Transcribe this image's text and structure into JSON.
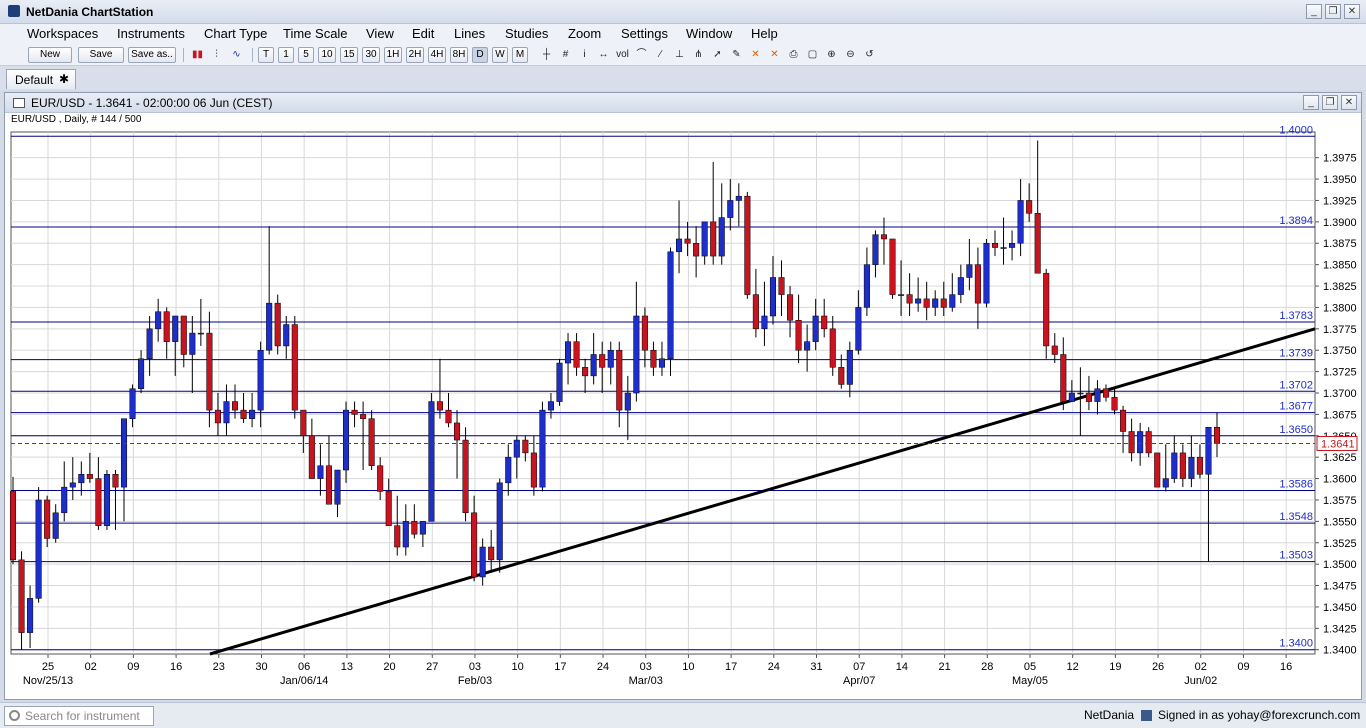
{
  "app": {
    "title": "NetDania ChartStation"
  },
  "menu": [
    "Workspaces",
    "Instruments",
    "Chart Type",
    "Time Scale",
    "View",
    "Edit",
    "Lines",
    "Studies",
    "Zoom",
    "Settings",
    "Window",
    "Help"
  ],
  "toolbar": {
    "new_label": "New",
    "save_label": "Save",
    "saveas_label": "Save as..",
    "timescales": [
      "T",
      "1",
      "5",
      "10",
      "15",
      "30",
      "1H",
      "2H",
      "4H",
      "8H",
      "D",
      "W",
      "M"
    ],
    "tools": [
      "crosshair-icon",
      "grid-icon",
      "info-icon",
      "scroll-icon",
      "volume-icon",
      "line-tool-icon",
      "fib-icon",
      "channel-icon",
      "pitchfork-icon",
      "cursor-icon",
      "pen-icon",
      "delete-lines-icon",
      "delete-studies-icon",
      "print-icon",
      "print-preview-icon",
      "zoom-in-icon",
      "zoom-out-icon",
      "zoom-reset-icon"
    ]
  },
  "tabs": [
    {
      "label": "Default",
      "close": "✱"
    }
  ],
  "chart_window": {
    "title": "EUR/USD - 1.3641 - 02:00:00  06 Jun (CEST)",
    "subtitle": "EUR/USD , Daily, # 144 / 500"
  },
  "chart_data": {
    "type": "candlestick",
    "instrument": "EUR/USD",
    "timeframe": "Daily",
    "ylim": [
      1.3395,
      1.4005
    ],
    "y_ticks": [
      "1.3400",
      "1.3425",
      "1.3450",
      "1.3475",
      "1.3500",
      "1.3525",
      "1.3550",
      "1.3575",
      "1.3600",
      "1.3625",
      "1.3650",
      "1.3675",
      "1.3700",
      "1.3725",
      "1.3750",
      "1.3775",
      "1.3800",
      "1.3825",
      "1.3850",
      "1.3875",
      "1.3900",
      "1.3925",
      "1.3950",
      "1.3975"
    ],
    "x_ticks": [
      "25",
      "02",
      "09",
      "16",
      "23",
      "30",
      "06",
      "13",
      "20",
      "27",
      "03",
      "10",
      "17",
      "24",
      "03",
      "10",
      "17",
      "24",
      "31",
      "07",
      "14",
      "21",
      "28",
      "05",
      "12",
      "19",
      "26",
      "02",
      "09",
      "16"
    ],
    "month_labels": [
      {
        "tick_index": 0,
        "label": "Nov/25/13"
      },
      {
        "tick_index": 6,
        "label": "Jan/06/14"
      },
      {
        "tick_index": 10,
        "label": "Feb/03"
      },
      {
        "tick_index": 14,
        "label": "Mar/03"
      },
      {
        "tick_index": 19,
        "label": "Apr/07"
      },
      {
        "tick_index": 23,
        "label": "May/05"
      },
      {
        "tick_index": 27,
        "label": "Jun/02"
      }
    ],
    "horizontal_levels": [
      "1.3400",
      "1.3503",
      "1.3548",
      "1.3586",
      "1.3650",
      "1.3677",
      "1.3702",
      "1.3739",
      "1.3783",
      "1.3894",
      "1.4000"
    ],
    "last_price": "1.3641",
    "trendline": {
      "from": [
        "2013-12-23",
        1.3395
      ],
      "to": [
        "2014-06-16",
        1.3775
      ]
    },
    "candles_ohlc": [
      [
        1.3585,
        1.3602,
        1.35,
        1.3505
      ],
      [
        1.3505,
        1.3515,
        1.34,
        1.342
      ],
      [
        1.342,
        1.3475,
        1.3402,
        1.346
      ],
      [
        1.346,
        1.359,
        1.3455,
        1.3575
      ],
      [
        1.3575,
        1.358,
        1.352,
        1.353
      ],
      [
        1.353,
        1.357,
        1.3525,
        1.356
      ],
      [
        1.356,
        1.362,
        1.355,
        1.359
      ],
      [
        1.359,
        1.3625,
        1.3575,
        1.3595
      ],
      [
        1.3595,
        1.362,
        1.358,
        1.3605
      ],
      [
        1.3605,
        1.363,
        1.3595,
        1.36
      ],
      [
        1.36,
        1.3625,
        1.354,
        1.3545
      ],
      [
        1.3545,
        1.361,
        1.354,
        1.3605
      ],
      [
        1.3605,
        1.361,
        1.354,
        1.359
      ],
      [
        1.359,
        1.367,
        1.355,
        1.367
      ],
      [
        1.367,
        1.371,
        1.366,
        1.3705
      ],
      [
        1.3705,
        1.375,
        1.37,
        1.374
      ],
      [
        1.374,
        1.379,
        1.372,
        1.3775
      ],
      [
        1.3775,
        1.381,
        1.376,
        1.3795
      ],
      [
        1.3795,
        1.38,
        1.374,
        1.376
      ],
      [
        1.376,
        1.379,
        1.372,
        1.379
      ],
      [
        1.379,
        1.379,
        1.373,
        1.3745
      ],
      [
        1.3745,
        1.379,
        1.37,
        1.377
      ],
      [
        1.377,
        1.381,
        1.3755,
        1.377
      ],
      [
        1.377,
        1.3795,
        1.366,
        1.368
      ],
      [
        1.368,
        1.37,
        1.365,
        1.3665
      ],
      [
        1.3665,
        1.371,
        1.365,
        1.369
      ],
      [
        1.369,
        1.371,
        1.367,
        1.368
      ],
      [
        1.368,
        1.37,
        1.3665,
        1.367
      ],
      [
        1.367,
        1.37,
        1.366,
        1.368
      ],
      [
        1.368,
        1.376,
        1.366,
        1.375
      ],
      [
        1.375,
        1.3895,
        1.3745,
        1.3805
      ],
      [
        1.3805,
        1.3815,
        1.3745,
        1.3755
      ],
      [
        1.3755,
        1.379,
        1.374,
        1.378
      ],
      [
        1.378,
        1.379,
        1.367,
        1.368
      ],
      [
        1.368,
        1.367,
        1.363,
        1.365
      ],
      [
        1.365,
        1.367,
        1.36,
        1.36
      ],
      [
        1.36,
        1.364,
        1.358,
        1.3615
      ],
      [
        1.3615,
        1.365,
        1.357,
        1.357
      ],
      [
        1.357,
        1.361,
        1.3555,
        1.361
      ],
      [
        1.361,
        1.369,
        1.3595,
        1.368
      ],
      [
        1.368,
        1.369,
        1.366,
        1.3675
      ],
      [
        1.3675,
        1.369,
        1.361,
        1.367
      ],
      [
        1.367,
        1.368,
        1.361,
        1.3615
      ],
      [
        1.3615,
        1.3625,
        1.3575,
        1.3585
      ],
      [
        1.3585,
        1.36,
        1.3545,
        1.3545
      ],
      [
        1.3545,
        1.358,
        1.351,
        1.352
      ],
      [
        1.352,
        1.357,
        1.351,
        1.355
      ],
      [
        1.355,
        1.357,
        1.353,
        1.3535
      ],
      [
        1.3535,
        1.355,
        1.352,
        1.355
      ],
      [
        1.355,
        1.37,
        1.355,
        1.369
      ],
      [
        1.369,
        1.374,
        1.367,
        1.368
      ],
      [
        1.368,
        1.37,
        1.366,
        1.3665
      ],
      [
        1.3665,
        1.368,
        1.36,
        1.3645
      ],
      [
        1.3645,
        1.366,
        1.355,
        1.356
      ],
      [
        1.356,
        1.358,
        1.348,
        1.3485
      ],
      [
        1.3485,
        1.353,
        1.3475,
        1.352
      ],
      [
        1.352,
        1.354,
        1.349,
        1.3505
      ],
      [
        1.3505,
        1.36,
        1.349,
        1.3595
      ],
      [
        1.3595,
        1.364,
        1.358,
        1.3625
      ],
      [
        1.3625,
        1.365,
        1.36,
        1.3645
      ],
      [
        1.3645,
        1.365,
        1.362,
        1.363
      ],
      [
        1.363,
        1.365,
        1.358,
        1.359
      ],
      [
        1.359,
        1.369,
        1.3585,
        1.368
      ],
      [
        1.368,
        1.37,
        1.367,
        1.369
      ],
      [
        1.369,
        1.374,
        1.3685,
        1.3735
      ],
      [
        1.3735,
        1.377,
        1.371,
        1.376
      ],
      [
        1.376,
        1.377,
        1.372,
        1.373
      ],
      [
        1.373,
        1.374,
        1.37,
        1.372
      ],
      [
        1.372,
        1.377,
        1.371,
        1.3745
      ],
      [
        1.3745,
        1.376,
        1.37,
        1.373
      ],
      [
        1.373,
        1.376,
        1.371,
        1.375
      ],
      [
        1.375,
        1.376,
        1.366,
        1.368
      ],
      [
        1.368,
        1.372,
        1.3645,
        1.37
      ],
      [
        1.37,
        1.383,
        1.369,
        1.379
      ],
      [
        1.379,
        1.38,
        1.373,
        1.375
      ],
      [
        1.375,
        1.376,
        1.372,
        1.373
      ],
      [
        1.373,
        1.376,
        1.372,
        1.374
      ],
      [
        1.374,
        1.387,
        1.372,
        1.3865
      ],
      [
        1.3865,
        1.3925,
        1.384,
        1.388
      ],
      [
        1.388,
        1.39,
        1.386,
        1.3875
      ],
      [
        1.3875,
        1.3895,
        1.3835,
        1.386
      ],
      [
        1.386,
        1.39,
        1.385,
        1.39
      ],
      [
        1.39,
        1.397,
        1.385,
        1.386
      ],
      [
        1.386,
        1.3945,
        1.385,
        1.3905
      ],
      [
        1.3905,
        1.395,
        1.389,
        1.3925
      ],
      [
        1.3925,
        1.3945,
        1.3895,
        1.393
      ],
      [
        1.393,
        1.3935,
        1.381,
        1.3815
      ],
      [
        1.3815,
        1.3845,
        1.3765,
        1.3775
      ],
      [
        1.3775,
        1.383,
        1.3755,
        1.379
      ],
      [
        1.379,
        1.386,
        1.378,
        1.3835
      ],
      [
        1.3835,
        1.3855,
        1.379,
        1.3815
      ],
      [
        1.3815,
        1.3825,
        1.3765,
        1.3785
      ],
      [
        1.3785,
        1.3815,
        1.3735,
        1.375
      ],
      [
        1.375,
        1.378,
        1.3725,
        1.376
      ],
      [
        1.376,
        1.381,
        1.375,
        1.379
      ],
      [
        1.379,
        1.381,
        1.3765,
        1.3775
      ],
      [
        1.3775,
        1.379,
        1.372,
        1.373
      ],
      [
        1.373,
        1.3745,
        1.3705,
        1.371
      ],
      [
        1.371,
        1.376,
        1.3695,
        1.375
      ],
      [
        1.375,
        1.382,
        1.3745,
        1.38
      ],
      [
        1.38,
        1.387,
        1.379,
        1.385
      ],
      [
        1.385,
        1.389,
        1.3835,
        1.3885
      ],
      [
        1.3885,
        1.3905,
        1.385,
        1.388
      ],
      [
        1.388,
        1.386,
        1.381,
        1.3815
      ],
      [
        1.3815,
        1.3855,
        1.379,
        1.3815
      ],
      [
        1.3815,
        1.384,
        1.379,
        1.3805
      ],
      [
        1.3805,
        1.3835,
        1.3795,
        1.381
      ],
      [
        1.381,
        1.383,
        1.3785,
        1.38
      ],
      [
        1.38,
        1.382,
        1.379,
        1.381
      ],
      [
        1.381,
        1.383,
        1.379,
        1.38
      ],
      [
        1.38,
        1.384,
        1.3795,
        1.3815
      ],
      [
        1.3815,
        1.385,
        1.3805,
        1.3835
      ],
      [
        1.3835,
        1.388,
        1.382,
        1.385
      ],
      [
        1.385,
        1.387,
        1.3775,
        1.3805
      ],
      [
        1.3805,
        1.388,
        1.38,
        1.3875
      ],
      [
        1.3875,
        1.389,
        1.386,
        1.387
      ],
      [
        1.387,
        1.3905,
        1.385,
        1.387
      ],
      [
        1.387,
        1.389,
        1.3855,
        1.3875
      ],
      [
        1.3875,
        1.395,
        1.386,
        1.3925
      ],
      [
        1.3925,
        1.3945,
        1.39,
        1.391
      ],
      [
        1.391,
        1.3995,
        1.384,
        1.384
      ],
      [
        1.384,
        1.3845,
        1.374,
        1.3755
      ],
      [
        1.3755,
        1.377,
        1.3735,
        1.3745
      ],
      [
        1.3745,
        1.3765,
        1.368,
        1.369
      ],
      [
        1.369,
        1.3715,
        1.369,
        1.37
      ],
      [
        1.37,
        1.373,
        1.365,
        1.37
      ],
      [
        1.37,
        1.372,
        1.368,
        1.369
      ],
      [
        1.369,
        1.3715,
        1.3675,
        1.3705
      ],
      [
        1.3705,
        1.371,
        1.369,
        1.3695
      ],
      [
        1.3695,
        1.3705,
        1.3675,
        1.368
      ],
      [
        1.368,
        1.3685,
        1.363,
        1.3655
      ],
      [
        1.3655,
        1.367,
        1.362,
        1.363
      ],
      [
        1.363,
        1.3665,
        1.3615,
        1.3655
      ],
      [
        1.3655,
        1.366,
        1.3625,
        1.363
      ],
      [
        1.363,
        1.363,
        1.359,
        1.359
      ],
      [
        1.359,
        1.364,
        1.3585,
        1.36
      ],
      [
        1.36,
        1.365,
        1.3595,
        1.363
      ],
      [
        1.363,
        1.364,
        1.359,
        1.36
      ],
      [
        1.36,
        1.365,
        1.359,
        1.3625
      ],
      [
        1.3625,
        1.364,
        1.36,
        1.3605
      ],
      [
        1.3605,
        1.366,
        1.3503,
        1.366
      ],
      [
        1.366,
        1.3677,
        1.3625,
        1.3641
      ]
    ]
  },
  "status": {
    "search_placeholder": "Search for instrument",
    "brand": "NetDania",
    "signed_in": "Signed in as yohay@forexcrunch.com"
  },
  "colors": {
    "bull": "#1e2ec8",
    "bear": "#c8141e",
    "level": "#00008b",
    "grid": "#d8d8d8",
    "last": "#c8141e"
  }
}
